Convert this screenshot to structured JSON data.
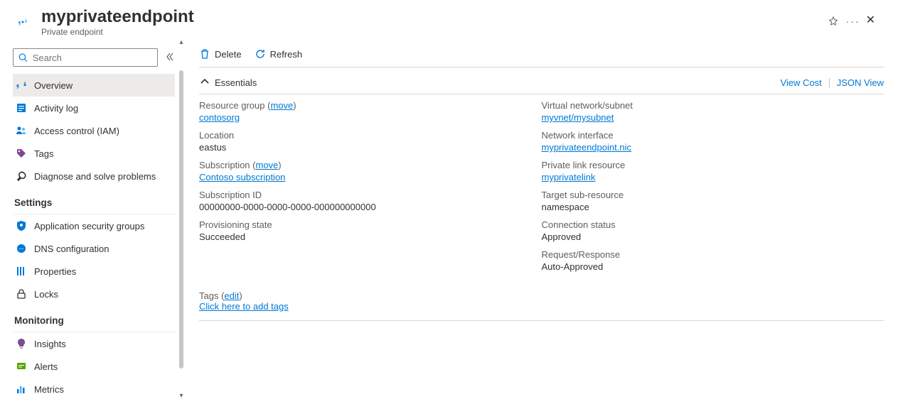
{
  "header": {
    "title": "myprivateendpoint",
    "subtitle": "Private endpoint"
  },
  "search": {
    "placeholder": "Search"
  },
  "nav": {
    "top": {
      "overview": "Overview",
      "activity": "Activity log",
      "iam": "Access control (IAM)",
      "tags": "Tags",
      "diag": "Diagnose and solve problems"
    },
    "settings_label": "Settings",
    "settings": {
      "asg": "Application security groups",
      "dns": "DNS configuration",
      "props": "Properties",
      "locks": "Locks"
    },
    "monitoring_label": "Monitoring",
    "monitoring": {
      "insights": "Insights",
      "alerts": "Alerts",
      "metrics": "Metrics"
    }
  },
  "toolbar": {
    "delete": "Delete",
    "refresh": "Refresh"
  },
  "essentials": {
    "label": "Essentials",
    "view_cost": "View Cost",
    "json_view": "JSON View",
    "left": {
      "rg_label": "Resource group",
      "move": "move",
      "rg_value": "contosorg",
      "loc_label": "Location",
      "loc_value": "eastus",
      "sub_label": "Subscription",
      "sub_value": "Contoso subscription",
      "subid_label": "Subscription ID",
      "subid_value": "00000000-0000-0000-0000-000000000000",
      "prov_label": "Provisioning state",
      "prov_value": "Succeeded"
    },
    "right": {
      "vnet_label": "Virtual network/subnet",
      "vnet_value": "myvnet/mysubnet",
      "nic_label": "Network interface",
      "nic_value": "myprivateendpoint.nic",
      "plr_label": "Private link resource",
      "plr_value": "myprivatelink",
      "tsr_label": "Target sub-resource",
      "tsr_value": "namespace",
      "conn_label": "Connection status",
      "conn_value": "Approved",
      "rr_label": "Request/Response",
      "rr_value": "Auto-Approved"
    }
  },
  "tags": {
    "label": "Tags",
    "edit": "edit",
    "add": "Click here to add tags"
  }
}
